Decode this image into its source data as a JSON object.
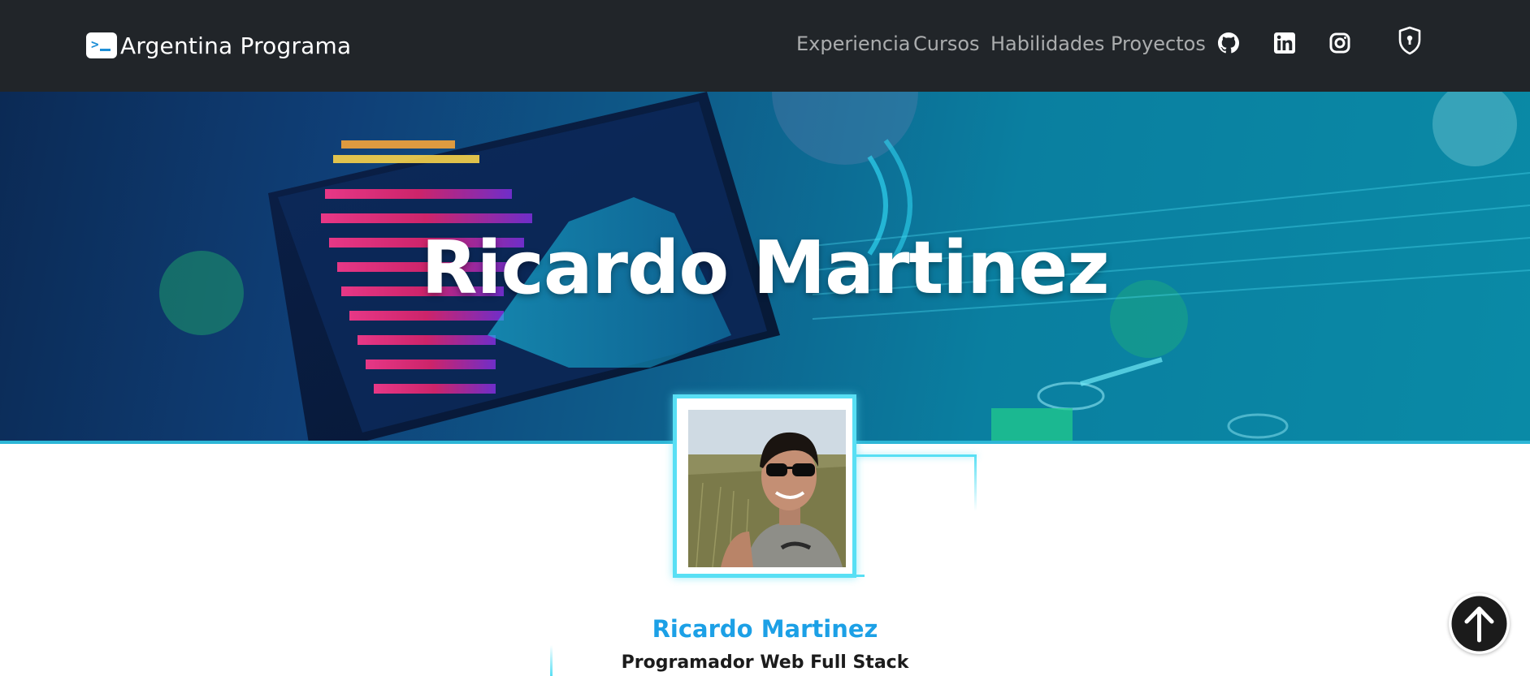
{
  "navbar": {
    "brand": "Argentina Programa",
    "links": [
      "Experiencia",
      "Cursos",
      "Habilidades",
      "Proyectos"
    ],
    "icons": [
      "github-icon",
      "linkedin-icon",
      "instagram-icon",
      "login-shield-icon"
    ]
  },
  "hero": {
    "title": "Ricardo Martinez"
  },
  "profile": {
    "name": "Ricardo Martinez",
    "role": "Programador Web Full Stack"
  },
  "colors": {
    "navbar_bg": "#212529",
    "accent_cyan": "#58dff4",
    "name_blue": "#1ca0e6"
  },
  "back_to_top_icon": "arrow-up-circle-icon"
}
